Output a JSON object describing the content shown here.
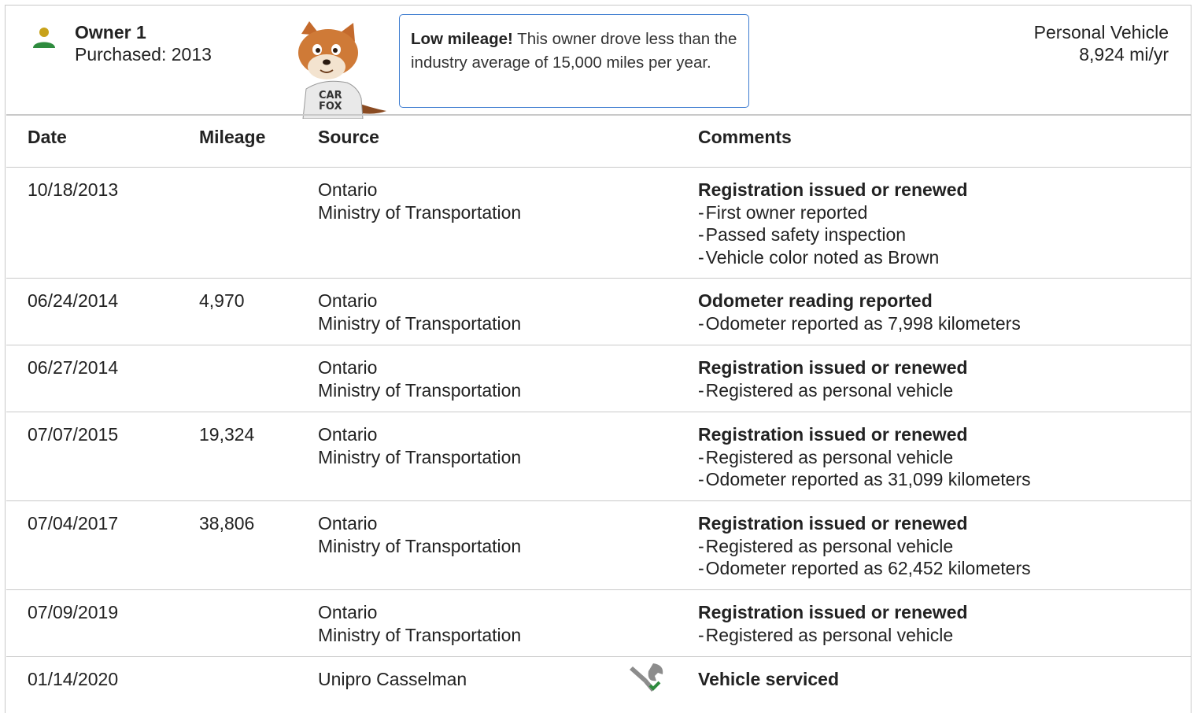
{
  "owner": {
    "title": "Owner 1",
    "purchased": "Purchased: 2013",
    "icon": "person-icon",
    "icon_colors": {
      "head": "#c8a21a",
      "body": "#2e8b3e"
    }
  },
  "callout": {
    "bold": "Low mileage!",
    "text": " This owner drove less than the industry average of 15,000 miles per year.",
    "border_color": "#3c7bd0"
  },
  "vehicle": {
    "type": "Personal Vehicle",
    "mileage": "8,924 mi/yr"
  },
  "table": {
    "headers": {
      "date": "Date",
      "mileage": "Mileage",
      "source": "Source",
      "comments": "Comments"
    },
    "rows": [
      {
        "date": "10/18/2013",
        "mileage": "",
        "source": [
          "Ontario",
          "Ministry of Transportation"
        ],
        "title": "Registration issued or renewed",
        "items": [
          "First owner reported",
          "Passed safety inspection",
          "Vehicle color noted as Brown"
        ]
      },
      {
        "date": "06/24/2014",
        "mileage": "4,970",
        "source": [
          "Ontario",
          "Ministry of Transportation"
        ],
        "title": "Odometer reading reported",
        "items": [
          "Odometer reported as 7,998 kilometers"
        ]
      },
      {
        "date": "06/27/2014",
        "mileage": "",
        "source": [
          "Ontario",
          "Ministry of Transportation"
        ],
        "title": "Registration issued or renewed",
        "items": [
          "Registered as personal vehicle"
        ]
      },
      {
        "date": "07/07/2015",
        "mileage": "19,324",
        "source": [
          "Ontario",
          "Ministry of Transportation"
        ],
        "title": "Registration issued or renewed",
        "items": [
          "Registered as personal vehicle",
          "Odometer reported as 31,099 kilometers"
        ]
      },
      {
        "date": "07/04/2017",
        "mileage": "38,806",
        "source": [
          "Ontario",
          "Ministry of Transportation"
        ],
        "title": "Registration issued or renewed",
        "items": [
          "Registered as personal vehicle",
          "Odometer reported as 62,452 kilometers"
        ]
      },
      {
        "date": "07/09/2019",
        "mileage": "",
        "source": [
          "Ontario",
          "Ministry of Transportation"
        ],
        "title": "Registration issued or renewed",
        "items": [
          "Registered as personal vehicle"
        ]
      },
      {
        "date": "01/14/2020",
        "mileage": "",
        "source": [
          "Unipro Casselman"
        ],
        "title": "Vehicle serviced",
        "items": [],
        "icon": "service-tools-icon"
      }
    ]
  },
  "mascot": {
    "shirt_text": "CAR FOX",
    "icon": "carfox-mascot-icon"
  }
}
